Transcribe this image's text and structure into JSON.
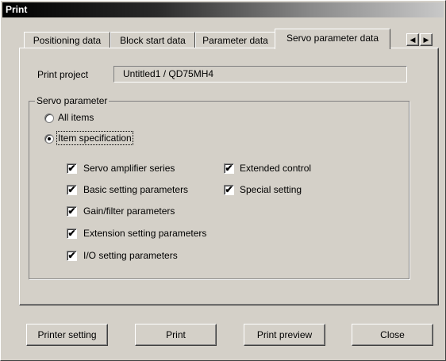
{
  "window": {
    "title": "Print"
  },
  "tabs": [
    {
      "label": "Positioning data"
    },
    {
      "label": "Block start data"
    },
    {
      "label": "Parameter data"
    },
    {
      "label": "Servo parameter data"
    }
  ],
  "active_tab": "Servo parameter data",
  "tab_scroll": {
    "left": "◀",
    "right": "▶"
  },
  "print_project": {
    "label": "Print project",
    "value": "Untitled1 / QD75MH4"
  },
  "servo_parameter": {
    "title": "Servo parameter",
    "radios": [
      {
        "label": "All items",
        "selected": false
      },
      {
        "label": "Item specification",
        "selected": true
      }
    ],
    "checkboxes": [
      {
        "label": "Servo amplifier series",
        "checked": true,
        "mark": "✔"
      },
      {
        "label": "Basic setting parameters",
        "checked": true,
        "mark": "✔"
      },
      {
        "label": "Gain/filter parameters",
        "checked": true,
        "mark": "✔"
      },
      {
        "label": "Extension setting parameters",
        "checked": true,
        "mark": "✔"
      },
      {
        "label": "I/O setting parameters",
        "checked": true,
        "mark": "✔"
      },
      {
        "label": "Extended control",
        "checked": true,
        "mark": "✔"
      },
      {
        "label": "Special setting",
        "checked": true,
        "mark": "✔"
      }
    ]
  },
  "buttons": {
    "printer_setting": "Printer setting",
    "print": "Print",
    "print_preview": "Print preview",
    "close": "Close"
  }
}
